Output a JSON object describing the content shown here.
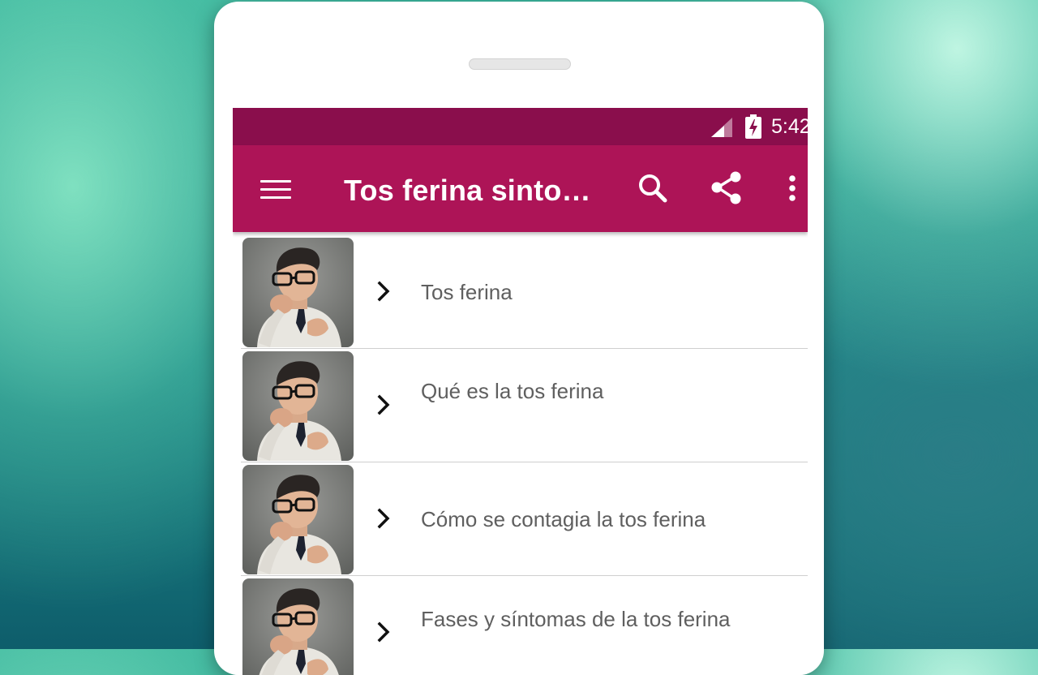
{
  "status_bar": {
    "time": "5:42",
    "signal_icon": "signal-icon",
    "battery_icon": "battery-charging-icon"
  },
  "toolbar": {
    "title": "Tos ferina sinto…",
    "menu_icon": "menu-icon",
    "search_icon": "search-icon",
    "share_icon": "share-icon",
    "more_icon": "more-vert-icon"
  },
  "list": {
    "items": [
      {
        "label": "Tos ferina",
        "thumbnail": "man-coughing-image"
      },
      {
        "label": "Qué es la tos ferina",
        "thumbnail": "man-coughing-image"
      },
      {
        "label": "Cómo se contagia la tos ferina",
        "thumbnail": "man-coughing-image"
      },
      {
        "label": "Fases y síntomas de la tos ferina",
        "thumbnail": "man-coughing-image"
      }
    ]
  },
  "colors": {
    "status_bar": "#8a0e4c",
    "toolbar": "#ad1457",
    "label_text": "#5f5f5f"
  }
}
